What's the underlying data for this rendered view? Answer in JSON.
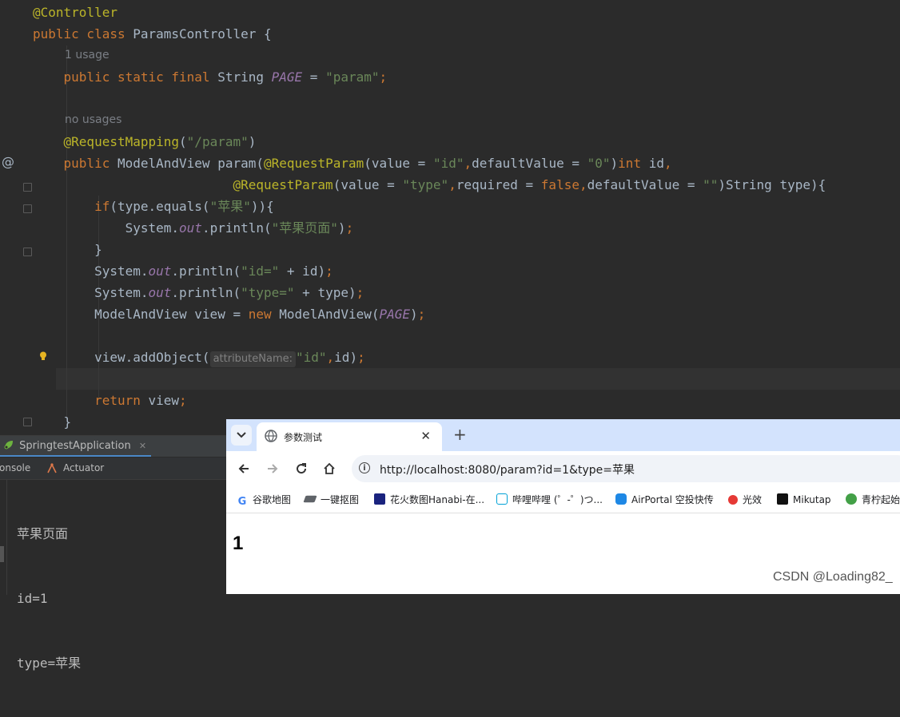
{
  "editor": {
    "lines": [
      {
        "segments": [
          {
            "t": "@Controller",
            "c": "ann"
          }
        ]
      },
      {
        "segments": [
          {
            "t": "public class ",
            "c": "kw"
          },
          {
            "t": "ParamsController {",
            "c": ""
          }
        ]
      },
      {
        "hint": "1 usage"
      },
      {
        "segments": [
          {
            "t": "    public static final ",
            "c": "kw"
          },
          {
            "t": "String ",
            "c": ""
          },
          {
            "t": "PAGE",
            "c": "cst"
          },
          {
            "t": " = ",
            "c": ""
          },
          {
            "t": "\"param\"",
            "c": "str"
          },
          {
            "t": ";",
            "c": "kw"
          }
        ]
      },
      {
        "segments": []
      },
      {
        "hint": "no usages"
      },
      {
        "segments": [
          {
            "t": "    @RequestMapping",
            "c": "ann"
          },
          {
            "t": "(",
            "c": ""
          },
          {
            "t": "\"/param\"",
            "c": "str"
          },
          {
            "t": ")",
            "c": ""
          }
        ]
      },
      {
        "segments": [
          {
            "t": "    public ",
            "c": "kw"
          },
          {
            "t": "ModelAndView ",
            "c": ""
          },
          {
            "t": "param",
            "c": "mth"
          },
          {
            "t": "(",
            "c": ""
          },
          {
            "t": "@RequestParam",
            "c": "ann"
          },
          {
            "t": "(value = ",
            "c": ""
          },
          {
            "t": "\"id\"",
            "c": "str"
          },
          {
            "t": ",",
            "c": "kw"
          },
          {
            "t": "defaultValue = ",
            "c": ""
          },
          {
            "t": "\"0\"",
            "c": "str"
          },
          {
            "t": ")",
            "c": ""
          },
          {
            "t": "int ",
            "c": "kw"
          },
          {
            "t": "id",
            "c": ""
          },
          {
            "t": ",",
            "c": "kw"
          }
        ]
      },
      {
        "segments": [
          {
            "t": "                          @RequestParam",
            "c": "ann"
          },
          {
            "t": "(value = ",
            "c": ""
          },
          {
            "t": "\"type\"",
            "c": "str"
          },
          {
            "t": ",",
            "c": "kw"
          },
          {
            "t": "required = ",
            "c": ""
          },
          {
            "t": "false",
            "c": "kw"
          },
          {
            "t": ",",
            "c": "kw"
          },
          {
            "t": "defaultValue = ",
            "c": ""
          },
          {
            "t": "\"\"",
            "c": "str"
          },
          {
            "t": ")String type){",
            "c": ""
          }
        ]
      },
      {
        "segments": [
          {
            "t": "        if",
            "c": "kw"
          },
          {
            "t": "(type.equals(",
            "c": ""
          },
          {
            "t": "\"苹果\"",
            "c": "str"
          },
          {
            "t": ")){",
            "c": ""
          }
        ]
      },
      {
        "segments": [
          {
            "t": "            System.",
            "c": ""
          },
          {
            "t": "out",
            "c": "fld"
          },
          {
            "t": ".println(",
            "c": ""
          },
          {
            "t": "\"苹果页面\"",
            "c": "str"
          },
          {
            "t": ")",
            "c": ""
          },
          {
            "t": ";",
            "c": "kw"
          }
        ]
      },
      {
        "segments": [
          {
            "t": "        }",
            "c": ""
          }
        ]
      },
      {
        "segments": [
          {
            "t": "        System.",
            "c": ""
          },
          {
            "t": "out",
            "c": "fld"
          },
          {
            "t": ".println(",
            "c": ""
          },
          {
            "t": "\"id=\"",
            "c": "str"
          },
          {
            "t": " + id)",
            "c": ""
          },
          {
            "t": ";",
            "c": "kw"
          }
        ]
      },
      {
        "segments": [
          {
            "t": "        System.",
            "c": ""
          },
          {
            "t": "out",
            "c": "fld"
          },
          {
            "t": ".println(",
            "c": ""
          },
          {
            "t": "\"type=\"",
            "c": "str"
          },
          {
            "t": " + type)",
            "c": ""
          },
          {
            "t": ";",
            "c": "kw"
          }
        ]
      },
      {
        "segments": [
          {
            "t": "        ModelAndView view = ",
            "c": ""
          },
          {
            "t": "new ",
            "c": "kw"
          },
          {
            "t": "ModelAndView(",
            "c": ""
          },
          {
            "t": "PAGE",
            "c": "cst"
          },
          {
            "t": ")",
            "c": ""
          },
          {
            "t": ";",
            "c": "kw"
          }
        ]
      },
      {
        "segments": []
      },
      {
        "segments": [
          {
            "t": "        view.addObject(",
            "c": ""
          },
          {
            "t": "attributeName:",
            "c": "inlay"
          },
          {
            "t": "\"id\"",
            "c": "str"
          },
          {
            "t": ",",
            "c": "kw"
          },
          {
            "t": "id)",
            "c": ""
          },
          {
            "t": ";",
            "c": "kw"
          }
        ]
      },
      {
        "segments": []
      },
      {
        "segments": [
          {
            "t": "        return ",
            "c": "kw"
          },
          {
            "t": "view",
            "c": ""
          },
          {
            "t": ";",
            "c": "kw"
          }
        ]
      },
      {
        "segments": [
          {
            "t": "    }",
            "c": ""
          }
        ]
      }
    ],
    "gutter_marker": "@"
  },
  "run_panel": {
    "tab_label": "SpringtestApplication",
    "subtabs": [
      "onsole",
      "Actuator"
    ],
    "console_lines": [
      "苹果页面",
      "id=1",
      "type=苹果"
    ]
  },
  "browser": {
    "tab_title": "参数测试",
    "url": "http://localhost:8080/param?id=1&type=苹果",
    "bookmarks": [
      {
        "label": "谷歌地图",
        "color": "#4285f4"
      },
      {
        "label": "一键抠图",
        "color": "#5f6368"
      },
      {
        "label": "花火数图Hanabi-在...",
        "color": "#1a237e"
      },
      {
        "label": "哔哩哔哩 (゜-゜)つ...",
        "color": "#00a1d6"
      },
      {
        "label": "AirPortal 空投快传",
        "color": "#1e88e5"
      },
      {
        "label": "光效",
        "color": "#e53935"
      },
      {
        "label": "Mikutap",
        "color": "#111111"
      },
      {
        "label": "青柠起始",
        "color": "#43a047"
      }
    ],
    "page_value": "1"
  },
  "watermark": "CSDN @Loading82_",
  "colors": {
    "editor_bg": "#2b2b2b",
    "keyword": "#cc7832",
    "annotation": "#bbb529",
    "string": "#6a8759",
    "constant": "#9876aa",
    "browser_tabstrip": "#d3e3fd"
  }
}
